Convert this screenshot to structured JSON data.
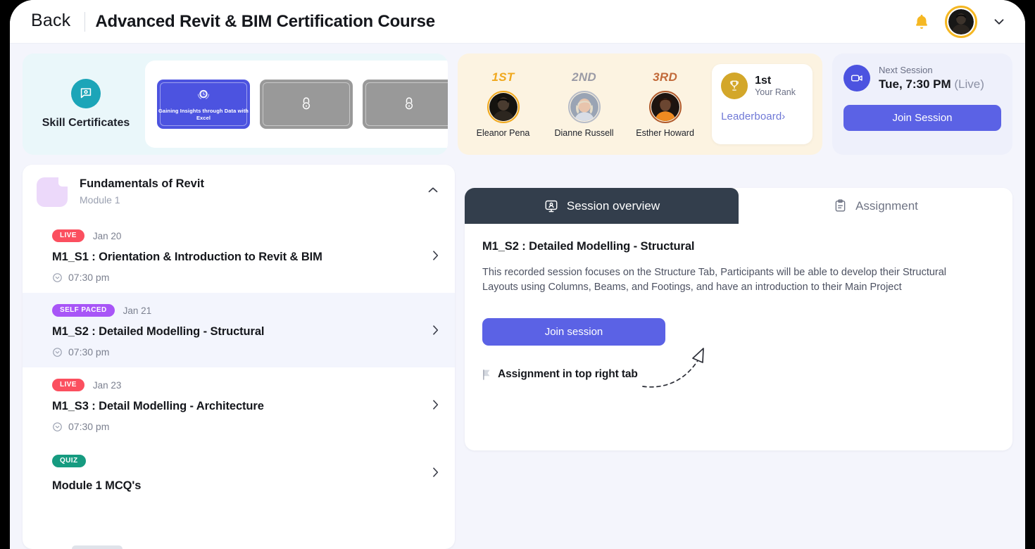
{
  "header": {
    "back_label": "Back",
    "course_title": "Advanced Revit & BIM Certification Course",
    "bell_icon": "bell-icon",
    "avatar_icon": "user-avatar",
    "chevron_icon": "chevron-down-icon"
  },
  "certificates": {
    "section_label": "Skill Certificates",
    "section_icon": "certificate-icon",
    "items": [
      {
        "title": "Gaining Insights through Data with Excel",
        "state": "unlocked",
        "icon": "seal-icon"
      },
      {
        "title": "",
        "state": "locked",
        "icon": "lock-icon"
      },
      {
        "title": "",
        "state": "locked",
        "icon": "lock-icon"
      }
    ]
  },
  "leaderboard": {
    "podium": [
      {
        "rank": "1ST",
        "name": "Eleanor Pena"
      },
      {
        "rank": "2ND",
        "name": "Dianne Russell"
      },
      {
        "rank": "3RD",
        "name": "Esther Howard"
      }
    ],
    "your_rank_value": "1st",
    "your_rank_label": "Your Rank",
    "trophy_icon": "trophy-icon",
    "link_label": "Leaderboard›"
  },
  "next_session": {
    "icon": "video-camera-icon",
    "label": "Next Session",
    "time": "Tue, 7:30 PM",
    "mode": "(Live)",
    "button_label": "Join Session"
  },
  "module": {
    "name": "Fundamentals of Revit",
    "subtitle": "Module 1",
    "collapse_icon": "chevron-up-icon",
    "sessions": [
      {
        "badge": "LIVE",
        "badge_type": "live",
        "date": "Jan 20",
        "title": "M1_S1 : Orientation & Introduction to Revit & BIM",
        "time": "07:30 pm",
        "selected": false,
        "clock_icon": "clock-icon",
        "chevron_icon": "chevron-right-icon"
      },
      {
        "badge": "SELF PACED",
        "badge_type": "self",
        "date": "Jan 21",
        "title": "M1_S2 : Detailed Modelling - Structural",
        "time": "07:30 pm",
        "selected": true,
        "clock_icon": "clock-icon",
        "chevron_icon": "chevron-right-icon"
      },
      {
        "badge": "LIVE",
        "badge_type": "live",
        "date": "Jan 23",
        "title": "M1_S3 : Detail Modelling - Architecture",
        "time": "07:30 pm",
        "selected": false,
        "clock_icon": "clock-icon",
        "chevron_icon": "chevron-right-icon"
      },
      {
        "badge": "QUIZ",
        "badge_type": "quiz",
        "date": "",
        "title": "Module 1 MCQ's",
        "time": "",
        "selected": false,
        "clock_icon": "",
        "chevron_icon": "chevron-right-icon"
      }
    ]
  },
  "detail": {
    "tabs": [
      {
        "label": "Session overview",
        "icon": "presentation-person-icon",
        "active": true
      },
      {
        "label": "Assignment",
        "icon": "clipboard-icon",
        "active": false
      }
    ],
    "title": "M1_S2 :  Detailed Modelling - Structural",
    "description": "This recorded session focuses on the Structure Tab, Participants will be able to develop their Structural Layouts using Columns, Beams, and Footings, and have an introduction to their Main Project",
    "join_button_label": "Join session",
    "annotation_text": "Assignment in top right tab",
    "annotation_icon": "pointer-flag-icon",
    "annotation_arrow_icon": "curved-arrow-icon"
  },
  "colors": {
    "accent_indigo": "#5b62e5",
    "certificate_teal": "#1ca5b8",
    "leaderboard_cream": "#fcf3e1",
    "gold": "#d3a72a",
    "live_red": "#fb4f5f",
    "self_paced_purple": "#a855f7",
    "quiz_green": "#169b80",
    "tab_dark": "#333e4c",
    "page_bg": "#f4f5fc"
  }
}
